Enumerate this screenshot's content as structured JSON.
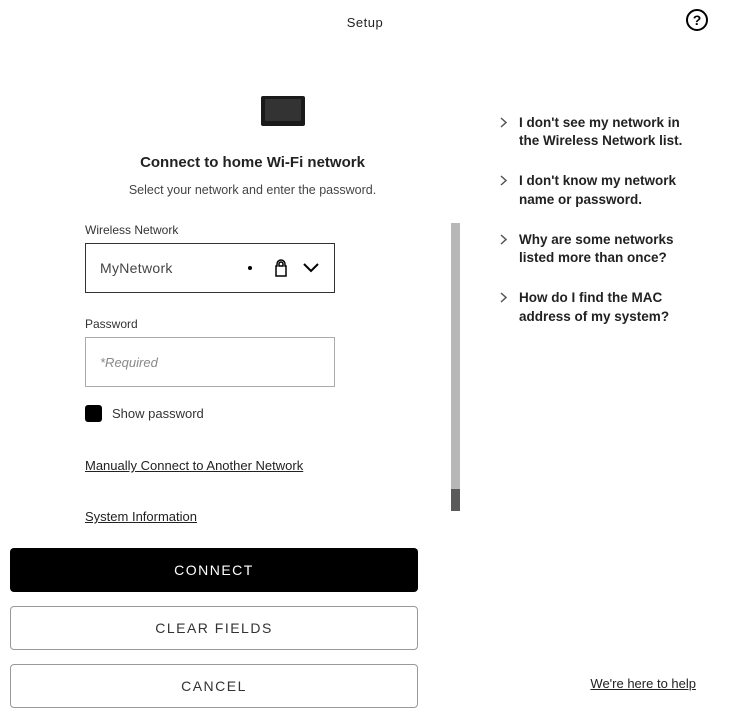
{
  "header": {
    "title": "Setup"
  },
  "main": {
    "heading": "Connect to home Wi-Fi network",
    "subtitle": "Select your network and enter the password.",
    "network_label": "Wireless Network",
    "network_value": "MyNetwork",
    "password_label": "Password",
    "password_placeholder": "*Required",
    "show_password_label": "Show password",
    "manual_link": "Manually Connect to Another Network",
    "system_info_link": "System Information"
  },
  "buttons": {
    "connect": "CONNECT",
    "clear": "CLEAR FIELDS",
    "cancel": "CANCEL"
  },
  "faq": [
    "I don't see my network in the Wireless Network list.",
    "I don't know my network name or password.",
    "Why are some networks listed more than once?",
    "How do I find the MAC address of my system?"
  ],
  "footer": {
    "help_link": "We're here to help"
  }
}
